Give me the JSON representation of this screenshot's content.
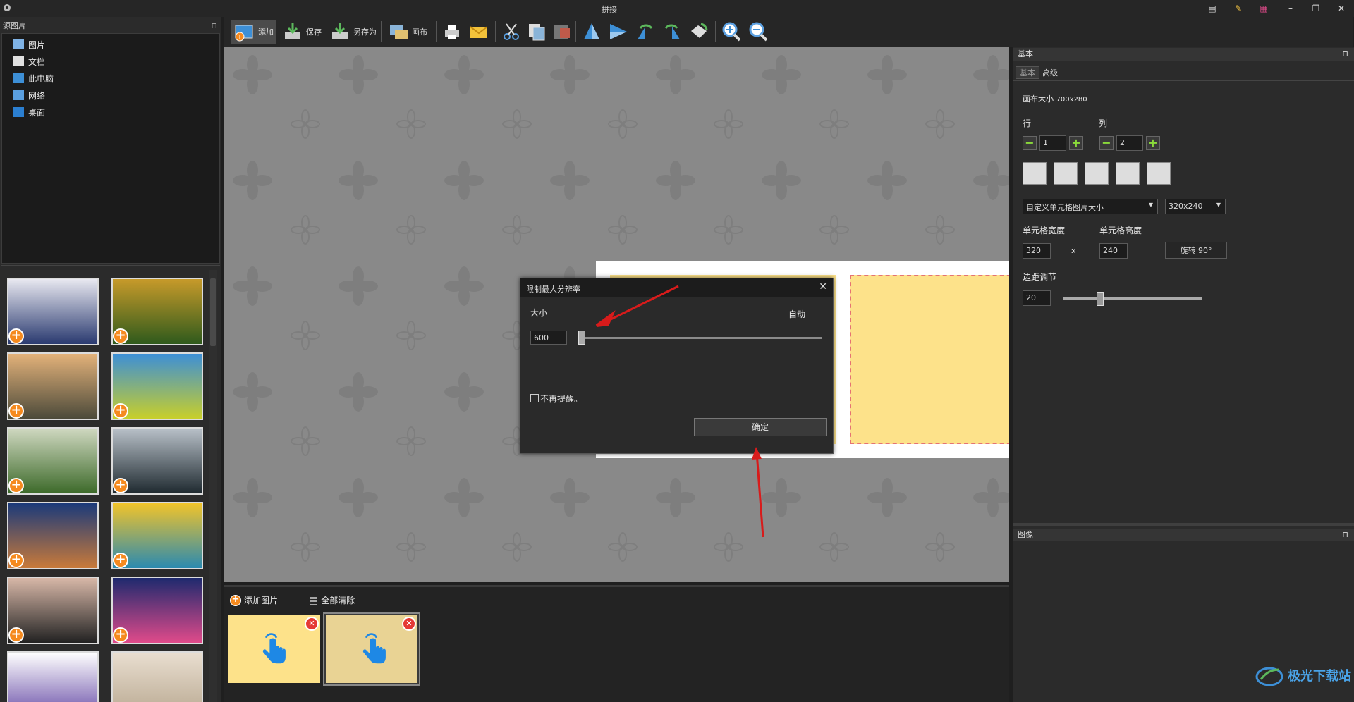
{
  "app": {
    "title": "拼接"
  },
  "left": {
    "source_header": "源图片",
    "tree": [
      {
        "label": "图片",
        "icon": "pictures-folder-icon"
      },
      {
        "label": "文档",
        "icon": "documents-folder-icon"
      },
      {
        "label": "此电脑",
        "icon": "this-pc-icon"
      },
      {
        "label": "网络",
        "icon": "network-icon"
      },
      {
        "label": "桌面",
        "icon": "desktop-folder-icon"
      }
    ],
    "thumbnails": [
      {
        "name": "thumb-screenshot-1",
        "colors": [
          "#e8e8f0",
          "#2a3a70"
        ]
      },
      {
        "name": "thumb-autumn-forest-road",
        "colors": [
          "#c79a2a",
          "#2f5a1c"
        ]
      },
      {
        "name": "thumb-misty-mountain-castle",
        "colors": [
          "#e3b27a",
          "#4c4a3a"
        ]
      },
      {
        "name": "thumb-tree-in-field",
        "colors": [
          "#3d8fd6",
          "#c8cf2a"
        ]
      },
      {
        "name": "thumb-green-misty-hills",
        "colors": [
          "#cfd8c0",
          "#3d6a2a"
        ]
      },
      {
        "name": "thumb-karst-river-fisherman",
        "colors": [
          "#b8c0c8",
          "#1f2a30"
        ]
      },
      {
        "name": "thumb-bridge-at-dusk",
        "colors": [
          "#1b3a7a",
          "#c97a3a"
        ]
      },
      {
        "name": "thumb-yellow-building-windows",
        "colors": [
          "#f2c42a",
          "#2a8ab0"
        ]
      },
      {
        "name": "thumb-portrait-woman",
        "colors": [
          "#d8b8a8",
          "#222222"
        ]
      },
      {
        "name": "thumb-app-grid-screenshot",
        "colors": [
          "#1e2a6e",
          "#e04a8a"
        ]
      },
      {
        "name": "thumb-screenshot-2",
        "colors": [
          "#ffffff",
          "#6a4fa8"
        ]
      },
      {
        "name": "thumb-desert-dunes",
        "colors": [
          "#e9ded0",
          "#b8a890"
        ]
      }
    ]
  },
  "toolbar": {
    "add": "添加",
    "save": "保存",
    "save_as": "另存为",
    "canvas": "画布"
  },
  "dialog": {
    "title": "限制最大分辨率",
    "size_label": "大小",
    "auto_label": "自动",
    "size_value": "600",
    "slider_fraction": 0.0,
    "dont_remind": "不再提醒。",
    "ok": "确定",
    "close": "✕"
  },
  "bottom": {
    "add_images": "添加图片",
    "clear_all": "全部清除"
  },
  "right": {
    "basic_header": "基本",
    "tabs": [
      "基本",
      "高级"
    ],
    "canvas_size_label": "画布大小",
    "canvas_size_value": "700x280",
    "rows_label": "行",
    "cols_label": "列",
    "rows_value": "1",
    "cols_value": "2",
    "cell_size_mode": "自定义单元格图片大小",
    "cell_size_preset": "320x240",
    "cell_width_label": "单元格宽度",
    "cell_height_label": "单元格高度",
    "cell_width": "320",
    "cell_height": "240",
    "times": "x",
    "rotate": "旋转 90°",
    "margin_label": "边距调节",
    "margin_value": "20",
    "margin_fraction": 0.25,
    "image_header": "图像",
    "pin": "⊓"
  },
  "colors": {
    "accent_orange": "#f58a1f",
    "cell_yellow": "#fde28a",
    "hand_blue": "#1e88e5",
    "close_red": "#e53935",
    "arrow_red": "#d81b1b"
  },
  "watermark": "极光下载站"
}
